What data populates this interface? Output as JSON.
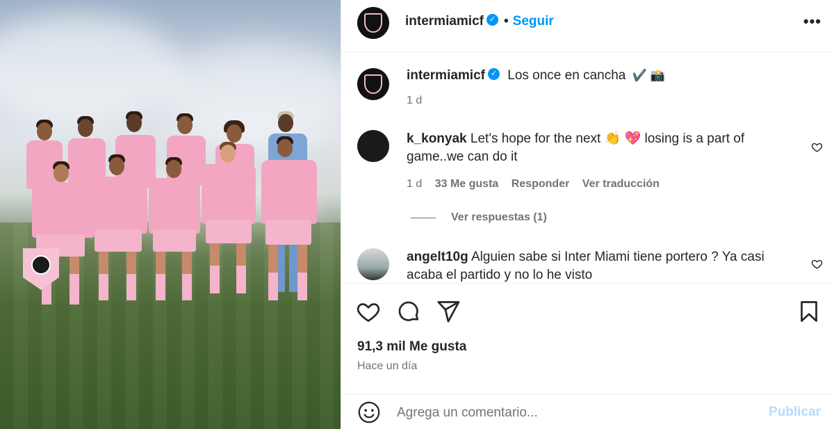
{
  "post": {
    "author": "intermiamicf",
    "follow_label": "Seguir",
    "more_label": "•••",
    "verified_glyph": "✓",
    "photo_icon": "team-photo"
  },
  "caption": {
    "username": "intermiamicf",
    "text": "Los once en cancha",
    "emoji": "✔️ 📸",
    "time": "1 d"
  },
  "comments": [
    {
      "username": "k_konyak",
      "text": "Let's hope for the next 👏 💖 losing is a part of game..we can do it",
      "time": "1 d",
      "likes": "33 Me gusta",
      "reply": "Responder",
      "translate": "Ver traducción"
    },
    {
      "username": "angelt10g",
      "text": "Alguien sabe si Inter Miami tiene portero ? Ya casi acaba el partido y no lo he visto"
    }
  ],
  "view_replies": "Ver respuestas (1)",
  "actions": {
    "likes": "91,3 mil Me gusta",
    "ago": "Hace un día"
  },
  "add_comment": {
    "placeholder": "Agrega un comentario...",
    "publish": "Publicar"
  },
  "colors": {
    "accent": "#0095f6",
    "muted": "#737373",
    "publish_disabled": "#b3dbff",
    "jersey": "#f2a6c1"
  }
}
